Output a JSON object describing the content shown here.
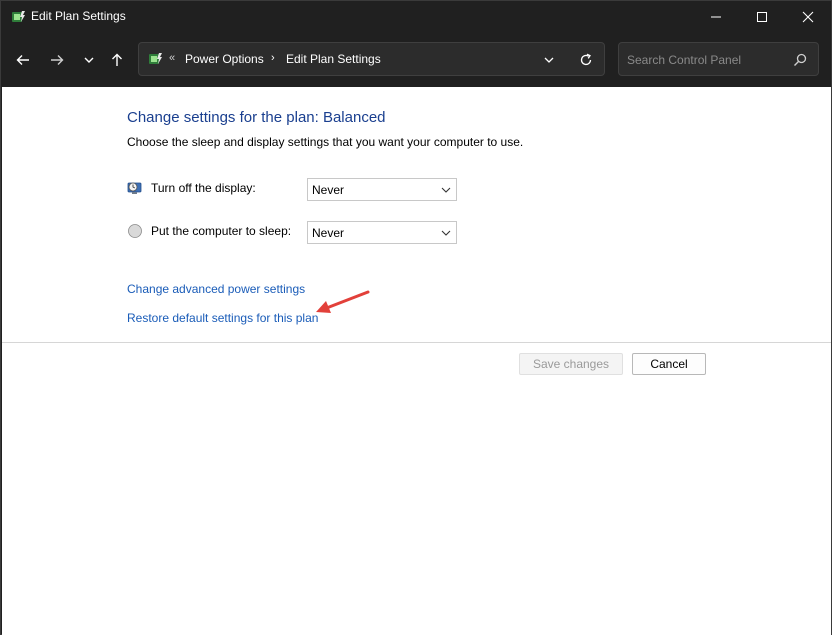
{
  "window": {
    "title": "Edit Plan Settings"
  },
  "nav": {
    "root_sep": "«",
    "crumbs": [
      "Power Options",
      "Edit Plan Settings"
    ],
    "crumb_chevron": "›",
    "search_placeholder": "Search Control Panel"
  },
  "content": {
    "heading": "Change settings for the plan: Balanced",
    "subheading": "Choose the sleep and display settings that you want your computer to use.",
    "settings": [
      {
        "label": "Turn off the display:",
        "value": "Never",
        "icon": "monitor-clock-icon"
      },
      {
        "label": "Put the computer to sleep:",
        "value": "Never",
        "icon": "moon-icon"
      }
    ],
    "links": {
      "advanced": "Change advanced power settings",
      "restore": "Restore default settings for this plan"
    },
    "buttons": {
      "save": "Save changes",
      "cancel": "Cancel"
    }
  },
  "colors": {
    "chrome": "#202020",
    "heading": "#1a3f8f",
    "link": "#1a5cb8",
    "annotation_arrow": "#e2403a"
  }
}
